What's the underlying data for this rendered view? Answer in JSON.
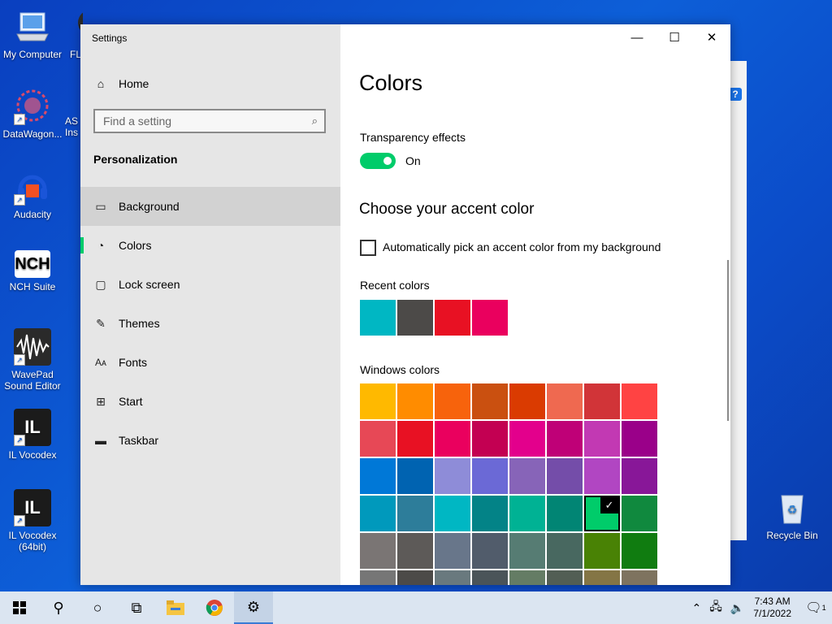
{
  "desktop": {
    "icons": [
      {
        "label": "My Computer"
      },
      {
        "label": "FL"
      },
      {
        "label": "DataWagon..."
      },
      {
        "label": "AS Ins"
      },
      {
        "label": "Audacity"
      },
      {
        "label": "NCH Suite"
      },
      {
        "label": "WavePad Sound Editor"
      },
      {
        "label": "IL Vocodex"
      },
      {
        "label": "IL Vocodex (64bit)"
      },
      {
        "label": "Recycle Bin"
      }
    ]
  },
  "window": {
    "title": "Settings",
    "controls": {
      "minimize": "—",
      "maximize": "☐",
      "close": "✕"
    }
  },
  "nav": {
    "home_label": "Home",
    "search_placeholder": "Find a setting",
    "section_title": "Personalization",
    "items": [
      {
        "label": "Background",
        "icon": "picture-icon"
      },
      {
        "label": "Colors",
        "icon": "palette-icon"
      },
      {
        "label": "Lock screen",
        "icon": "lock-screen-icon"
      },
      {
        "label": "Themes",
        "icon": "brush-icon"
      },
      {
        "label": "Fonts",
        "icon": "font-icon"
      },
      {
        "label": "Start",
        "icon": "start-icon"
      },
      {
        "label": "Taskbar",
        "icon": "taskbar-icon"
      }
    ],
    "selected": "Colors",
    "hovered": "Background"
  },
  "content": {
    "title": "Colors",
    "transparency_label": "Transparency effects",
    "transparency_state": "On",
    "accent_title": "Choose your accent color",
    "auto_pick_label": "Automatically pick an accent color from my background",
    "recent_label": "Recent colors",
    "recent_colors": [
      "#00b7c3",
      "#4c4a48",
      "#e81123",
      "#ea005e"
    ],
    "windows_label": "Windows colors",
    "windows_colors": [
      "#ffb900",
      "#ff8c00",
      "#f7630c",
      "#ca5010",
      "#da3b01",
      "#ef6950",
      "#d13438",
      "#ff4343",
      "#e74856",
      "#e81123",
      "#ea005e",
      "#c30052",
      "#e3008c",
      "#bf0077",
      "#c239b3",
      "#9a0089",
      "#0078d7",
      "#0063b1",
      "#8e8cd8",
      "#6b69d6",
      "#8764b8",
      "#744da9",
      "#b146c2",
      "#881798",
      "#0099bc",
      "#2d7d9a",
      "#00b7c3",
      "#038387",
      "#00b294",
      "#018574",
      "#00cc6a",
      "#10893e",
      "#7a7574",
      "#5d5a58",
      "#68768a",
      "#515c6b",
      "#567c73",
      "#486860",
      "#498205",
      "#107c10",
      "#767676",
      "#4c4a48",
      "#69797e",
      "#4a5459",
      "#647c64",
      "#525e54",
      "#847545",
      "#7e735f"
    ],
    "selected_color": "#00cc6a"
  },
  "taskbar": {
    "time": "7:43 AM",
    "date": "7/1/2022",
    "notification_count": "1"
  }
}
